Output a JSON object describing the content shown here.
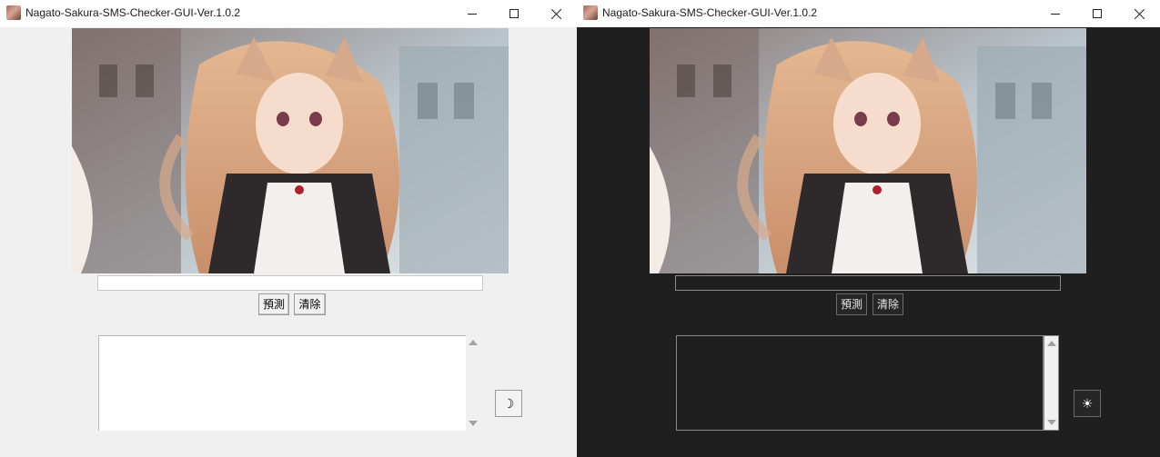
{
  "windows": [
    {
      "theme": "light",
      "title": "Nagato-Sakura-SMS-Checker-GUI-Ver.1.0.2",
      "sms_input": "",
      "predict_button": "預測",
      "clear_button": "清除",
      "result_text": "",
      "theme_toggle_glyph": "☽",
      "theme_toggle_icon": "moon-icon"
    },
    {
      "theme": "dark",
      "title": "Nagato-Sakura-SMS-Checker-GUI-Ver.1.0.2",
      "sms_input": "",
      "predict_button": "預測",
      "clear_button": "清除",
      "result_text": "",
      "theme_toggle_glyph": "☀",
      "theme_toggle_icon": "sun-icon"
    }
  ],
  "colors": {
    "light_bg": "#f0f0f0",
    "dark_bg": "#1f1f1f",
    "titlebar_bg": "#ffffff",
    "field_white": "#ffffff"
  },
  "icons": {
    "app": "app-icon",
    "minimize": "minimize-icon",
    "maximize": "maximize-icon",
    "close": "close-icon",
    "scroll_up": "scroll-up-arrow-icon",
    "scroll_down": "scroll-down-arrow-icon"
  }
}
